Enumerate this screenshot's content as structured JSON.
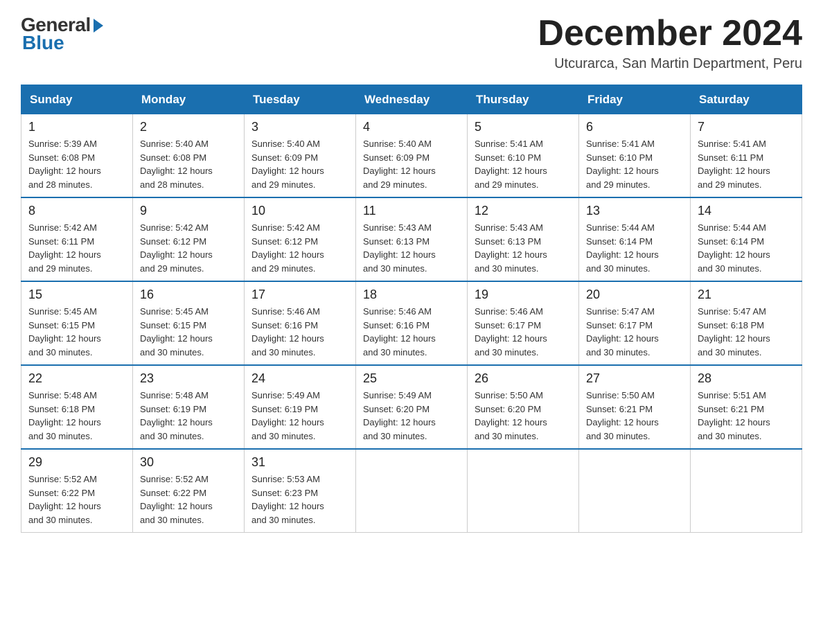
{
  "logo": {
    "general": "General",
    "blue": "Blue"
  },
  "title": "December 2024",
  "location": "Utcurarca, San Martin Department, Peru",
  "days_of_week": [
    "Sunday",
    "Monday",
    "Tuesday",
    "Wednesday",
    "Thursday",
    "Friday",
    "Saturday"
  ],
  "weeks": [
    [
      {
        "day": "1",
        "sunrise": "5:39 AM",
        "sunset": "6:08 PM",
        "daylight": "12 hours and 28 minutes."
      },
      {
        "day": "2",
        "sunrise": "5:40 AM",
        "sunset": "6:08 PM",
        "daylight": "12 hours and 28 minutes."
      },
      {
        "day": "3",
        "sunrise": "5:40 AM",
        "sunset": "6:09 PM",
        "daylight": "12 hours and 29 minutes."
      },
      {
        "day": "4",
        "sunrise": "5:40 AM",
        "sunset": "6:09 PM",
        "daylight": "12 hours and 29 minutes."
      },
      {
        "day": "5",
        "sunrise": "5:41 AM",
        "sunset": "6:10 PM",
        "daylight": "12 hours and 29 minutes."
      },
      {
        "day": "6",
        "sunrise": "5:41 AM",
        "sunset": "6:10 PM",
        "daylight": "12 hours and 29 minutes."
      },
      {
        "day": "7",
        "sunrise": "5:41 AM",
        "sunset": "6:11 PM",
        "daylight": "12 hours and 29 minutes."
      }
    ],
    [
      {
        "day": "8",
        "sunrise": "5:42 AM",
        "sunset": "6:11 PM",
        "daylight": "12 hours and 29 minutes."
      },
      {
        "day": "9",
        "sunrise": "5:42 AM",
        "sunset": "6:12 PM",
        "daylight": "12 hours and 29 minutes."
      },
      {
        "day": "10",
        "sunrise": "5:42 AM",
        "sunset": "6:12 PM",
        "daylight": "12 hours and 29 minutes."
      },
      {
        "day": "11",
        "sunrise": "5:43 AM",
        "sunset": "6:13 PM",
        "daylight": "12 hours and 30 minutes."
      },
      {
        "day": "12",
        "sunrise": "5:43 AM",
        "sunset": "6:13 PM",
        "daylight": "12 hours and 30 minutes."
      },
      {
        "day": "13",
        "sunrise": "5:44 AM",
        "sunset": "6:14 PM",
        "daylight": "12 hours and 30 minutes."
      },
      {
        "day": "14",
        "sunrise": "5:44 AM",
        "sunset": "6:14 PM",
        "daylight": "12 hours and 30 minutes."
      }
    ],
    [
      {
        "day": "15",
        "sunrise": "5:45 AM",
        "sunset": "6:15 PM",
        "daylight": "12 hours and 30 minutes."
      },
      {
        "day": "16",
        "sunrise": "5:45 AM",
        "sunset": "6:15 PM",
        "daylight": "12 hours and 30 minutes."
      },
      {
        "day": "17",
        "sunrise": "5:46 AM",
        "sunset": "6:16 PM",
        "daylight": "12 hours and 30 minutes."
      },
      {
        "day": "18",
        "sunrise": "5:46 AM",
        "sunset": "6:16 PM",
        "daylight": "12 hours and 30 minutes."
      },
      {
        "day": "19",
        "sunrise": "5:46 AM",
        "sunset": "6:17 PM",
        "daylight": "12 hours and 30 minutes."
      },
      {
        "day": "20",
        "sunrise": "5:47 AM",
        "sunset": "6:17 PM",
        "daylight": "12 hours and 30 minutes."
      },
      {
        "day": "21",
        "sunrise": "5:47 AM",
        "sunset": "6:18 PM",
        "daylight": "12 hours and 30 minutes."
      }
    ],
    [
      {
        "day": "22",
        "sunrise": "5:48 AM",
        "sunset": "6:18 PM",
        "daylight": "12 hours and 30 minutes."
      },
      {
        "day": "23",
        "sunrise": "5:48 AM",
        "sunset": "6:19 PM",
        "daylight": "12 hours and 30 minutes."
      },
      {
        "day": "24",
        "sunrise": "5:49 AM",
        "sunset": "6:19 PM",
        "daylight": "12 hours and 30 minutes."
      },
      {
        "day": "25",
        "sunrise": "5:49 AM",
        "sunset": "6:20 PM",
        "daylight": "12 hours and 30 minutes."
      },
      {
        "day": "26",
        "sunrise": "5:50 AM",
        "sunset": "6:20 PM",
        "daylight": "12 hours and 30 minutes."
      },
      {
        "day": "27",
        "sunrise": "5:50 AM",
        "sunset": "6:21 PM",
        "daylight": "12 hours and 30 minutes."
      },
      {
        "day": "28",
        "sunrise": "5:51 AM",
        "sunset": "6:21 PM",
        "daylight": "12 hours and 30 minutes."
      }
    ],
    [
      {
        "day": "29",
        "sunrise": "5:52 AM",
        "sunset": "6:22 PM",
        "daylight": "12 hours and 30 minutes."
      },
      {
        "day": "30",
        "sunrise": "5:52 AM",
        "sunset": "6:22 PM",
        "daylight": "12 hours and 30 minutes."
      },
      {
        "day": "31",
        "sunrise": "5:53 AM",
        "sunset": "6:23 PM",
        "daylight": "12 hours and 30 minutes."
      },
      null,
      null,
      null,
      null
    ]
  ],
  "labels": {
    "sunrise": "Sunrise:",
    "sunset": "Sunset:",
    "daylight": "Daylight:"
  }
}
